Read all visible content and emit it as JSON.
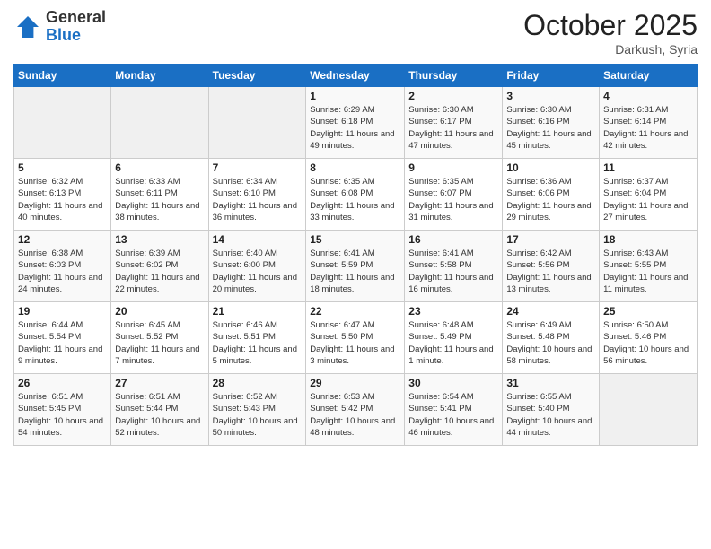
{
  "header": {
    "logo_general": "General",
    "logo_blue": "Blue",
    "month_title": "October 2025",
    "location": "Darkush, Syria"
  },
  "days_of_week": [
    "Sunday",
    "Monday",
    "Tuesday",
    "Wednesday",
    "Thursday",
    "Friday",
    "Saturday"
  ],
  "weeks": [
    [
      {
        "day": "",
        "sunrise": "",
        "sunset": "",
        "daylight": ""
      },
      {
        "day": "",
        "sunrise": "",
        "sunset": "",
        "daylight": ""
      },
      {
        "day": "",
        "sunrise": "",
        "sunset": "",
        "daylight": ""
      },
      {
        "day": "1",
        "sunrise": "Sunrise: 6:29 AM",
        "sunset": "Sunset: 6:18 PM",
        "daylight": "Daylight: 11 hours and 49 minutes."
      },
      {
        "day": "2",
        "sunrise": "Sunrise: 6:30 AM",
        "sunset": "Sunset: 6:17 PM",
        "daylight": "Daylight: 11 hours and 47 minutes."
      },
      {
        "day": "3",
        "sunrise": "Sunrise: 6:30 AM",
        "sunset": "Sunset: 6:16 PM",
        "daylight": "Daylight: 11 hours and 45 minutes."
      },
      {
        "day": "4",
        "sunrise": "Sunrise: 6:31 AM",
        "sunset": "Sunset: 6:14 PM",
        "daylight": "Daylight: 11 hours and 42 minutes."
      }
    ],
    [
      {
        "day": "5",
        "sunrise": "Sunrise: 6:32 AM",
        "sunset": "Sunset: 6:13 PM",
        "daylight": "Daylight: 11 hours and 40 minutes."
      },
      {
        "day": "6",
        "sunrise": "Sunrise: 6:33 AM",
        "sunset": "Sunset: 6:11 PM",
        "daylight": "Daylight: 11 hours and 38 minutes."
      },
      {
        "day": "7",
        "sunrise": "Sunrise: 6:34 AM",
        "sunset": "Sunset: 6:10 PM",
        "daylight": "Daylight: 11 hours and 36 minutes."
      },
      {
        "day": "8",
        "sunrise": "Sunrise: 6:35 AM",
        "sunset": "Sunset: 6:08 PM",
        "daylight": "Daylight: 11 hours and 33 minutes."
      },
      {
        "day": "9",
        "sunrise": "Sunrise: 6:35 AM",
        "sunset": "Sunset: 6:07 PM",
        "daylight": "Daylight: 11 hours and 31 minutes."
      },
      {
        "day": "10",
        "sunrise": "Sunrise: 6:36 AM",
        "sunset": "Sunset: 6:06 PM",
        "daylight": "Daylight: 11 hours and 29 minutes."
      },
      {
        "day": "11",
        "sunrise": "Sunrise: 6:37 AM",
        "sunset": "Sunset: 6:04 PM",
        "daylight": "Daylight: 11 hours and 27 minutes."
      }
    ],
    [
      {
        "day": "12",
        "sunrise": "Sunrise: 6:38 AM",
        "sunset": "Sunset: 6:03 PM",
        "daylight": "Daylight: 11 hours and 24 minutes."
      },
      {
        "day": "13",
        "sunrise": "Sunrise: 6:39 AM",
        "sunset": "Sunset: 6:02 PM",
        "daylight": "Daylight: 11 hours and 22 minutes."
      },
      {
        "day": "14",
        "sunrise": "Sunrise: 6:40 AM",
        "sunset": "Sunset: 6:00 PM",
        "daylight": "Daylight: 11 hours and 20 minutes."
      },
      {
        "day": "15",
        "sunrise": "Sunrise: 6:41 AM",
        "sunset": "Sunset: 5:59 PM",
        "daylight": "Daylight: 11 hours and 18 minutes."
      },
      {
        "day": "16",
        "sunrise": "Sunrise: 6:41 AM",
        "sunset": "Sunset: 5:58 PM",
        "daylight": "Daylight: 11 hours and 16 minutes."
      },
      {
        "day": "17",
        "sunrise": "Sunrise: 6:42 AM",
        "sunset": "Sunset: 5:56 PM",
        "daylight": "Daylight: 11 hours and 13 minutes."
      },
      {
        "day": "18",
        "sunrise": "Sunrise: 6:43 AM",
        "sunset": "Sunset: 5:55 PM",
        "daylight": "Daylight: 11 hours and 11 minutes."
      }
    ],
    [
      {
        "day": "19",
        "sunrise": "Sunrise: 6:44 AM",
        "sunset": "Sunset: 5:54 PM",
        "daylight": "Daylight: 11 hours and 9 minutes."
      },
      {
        "day": "20",
        "sunrise": "Sunrise: 6:45 AM",
        "sunset": "Sunset: 5:52 PM",
        "daylight": "Daylight: 11 hours and 7 minutes."
      },
      {
        "day": "21",
        "sunrise": "Sunrise: 6:46 AM",
        "sunset": "Sunset: 5:51 PM",
        "daylight": "Daylight: 11 hours and 5 minutes."
      },
      {
        "day": "22",
        "sunrise": "Sunrise: 6:47 AM",
        "sunset": "Sunset: 5:50 PM",
        "daylight": "Daylight: 11 hours and 3 minutes."
      },
      {
        "day": "23",
        "sunrise": "Sunrise: 6:48 AM",
        "sunset": "Sunset: 5:49 PM",
        "daylight": "Daylight: 11 hours and 1 minute."
      },
      {
        "day": "24",
        "sunrise": "Sunrise: 6:49 AM",
        "sunset": "Sunset: 5:48 PM",
        "daylight": "Daylight: 10 hours and 58 minutes."
      },
      {
        "day": "25",
        "sunrise": "Sunrise: 6:50 AM",
        "sunset": "Sunset: 5:46 PM",
        "daylight": "Daylight: 10 hours and 56 minutes."
      }
    ],
    [
      {
        "day": "26",
        "sunrise": "Sunrise: 6:51 AM",
        "sunset": "Sunset: 5:45 PM",
        "daylight": "Daylight: 10 hours and 54 minutes."
      },
      {
        "day": "27",
        "sunrise": "Sunrise: 6:51 AM",
        "sunset": "Sunset: 5:44 PM",
        "daylight": "Daylight: 10 hours and 52 minutes."
      },
      {
        "day": "28",
        "sunrise": "Sunrise: 6:52 AM",
        "sunset": "Sunset: 5:43 PM",
        "daylight": "Daylight: 10 hours and 50 minutes."
      },
      {
        "day": "29",
        "sunrise": "Sunrise: 6:53 AM",
        "sunset": "Sunset: 5:42 PM",
        "daylight": "Daylight: 10 hours and 48 minutes."
      },
      {
        "day": "30",
        "sunrise": "Sunrise: 6:54 AM",
        "sunset": "Sunset: 5:41 PM",
        "daylight": "Daylight: 10 hours and 46 minutes."
      },
      {
        "day": "31",
        "sunrise": "Sunrise: 6:55 AM",
        "sunset": "Sunset: 5:40 PM",
        "daylight": "Daylight: 10 hours and 44 minutes."
      },
      {
        "day": "",
        "sunrise": "",
        "sunset": "",
        "daylight": ""
      }
    ]
  ]
}
